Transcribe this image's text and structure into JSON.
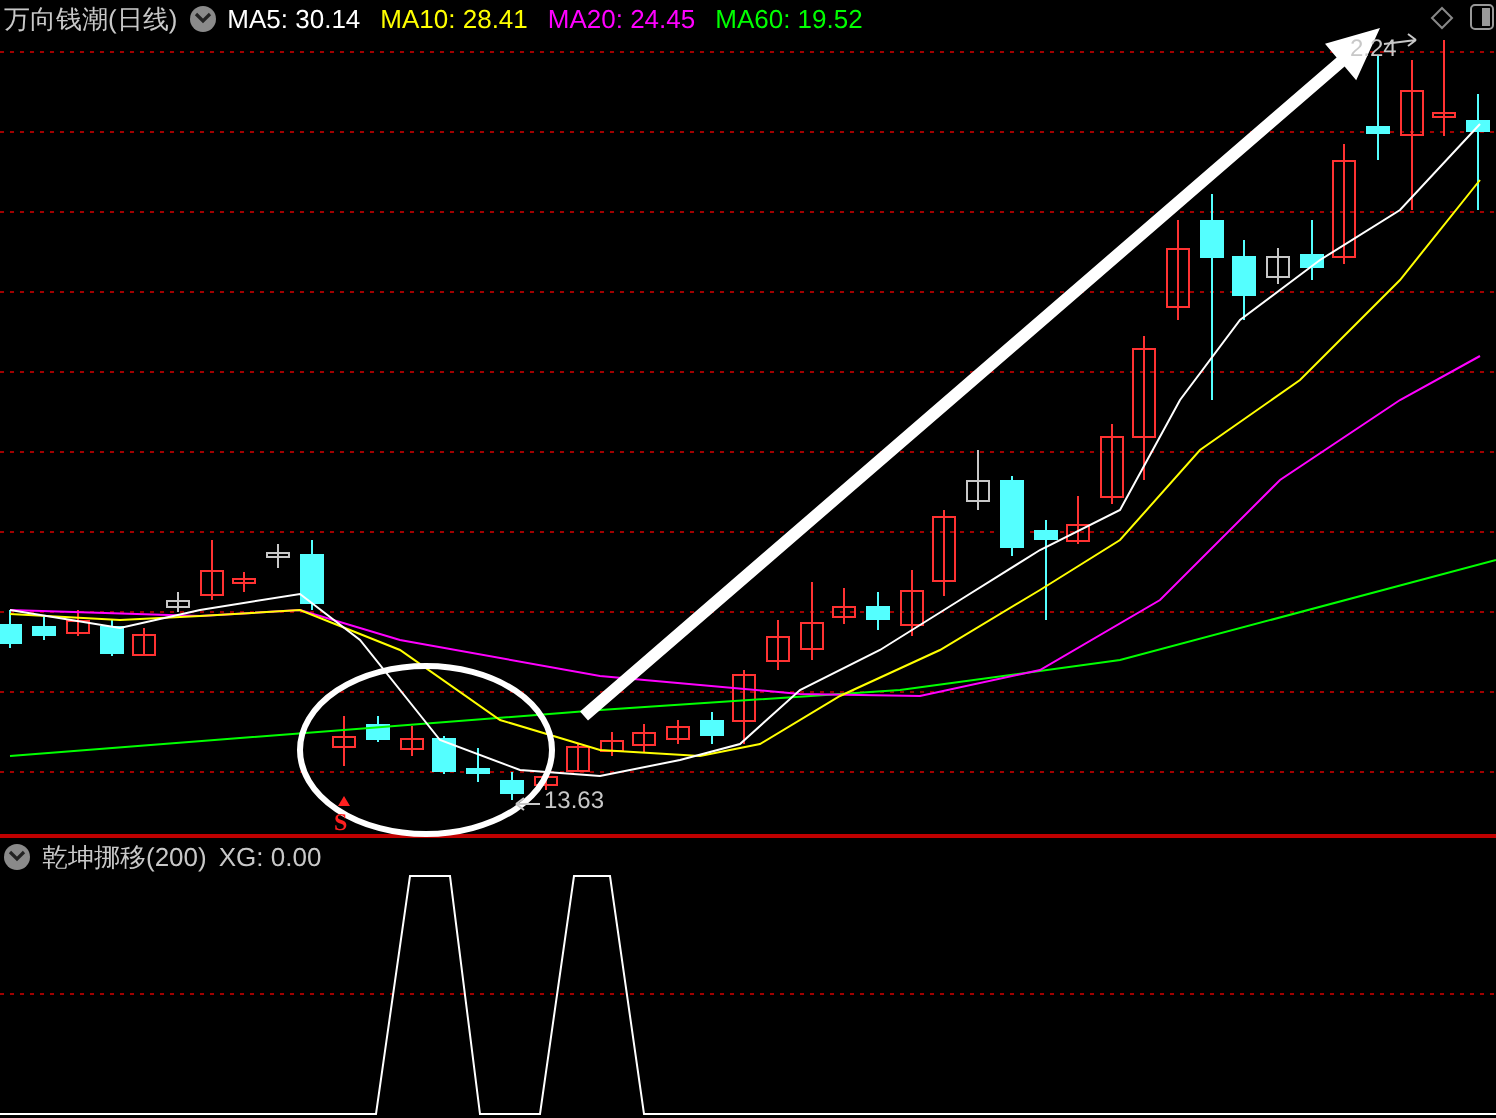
{
  "main_panel": {
    "title": "万向钱潮(日线)",
    "indicators": [
      {
        "label": "MA5: 30.14",
        "color": "#ffffff"
      },
      {
        "label": "MA10: 28.41",
        "color": "#ffff00"
      },
      {
        "label": "MA20: 24.45",
        "color": "#ff00ff"
      },
      {
        "label": "MA60: 19.52",
        "color": "#00ff00"
      }
    ],
    "high_label": "2.24",
    "low_label": "13.63",
    "signal_mark": "S"
  },
  "sub_panel": {
    "title": "乾坤挪移(200)",
    "reading": "XG: 0.00"
  }
}
